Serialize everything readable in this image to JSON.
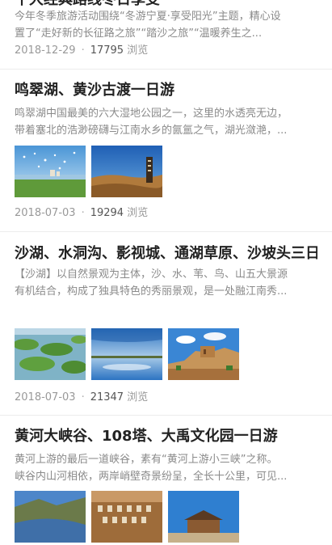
{
  "articles": [
    {
      "title": "十大经典路线冬日享受",
      "summary_lines": [
        "今年冬季旅游活动围绕“冬游宁夏·享受阳光”主题，精心设",
        "置了“走好新的长征路之旅”“踏沙之旅”“温暖养生之..."
      ],
      "date": "2018-12-29",
      "views": "17795",
      "views_label": "浏览"
    },
    {
      "title": "鸣翠湖、黄沙古渡一日游",
      "summary_lines": [
        "鸣翠湖中国最美的六大湿地公园之一，这里的水透亮无边，",
        "带着塞北的浩渺磅礴与江南水乡的氤氲之气，湖光潋滟，..."
      ],
      "date": "2018-07-03",
      "views": "19294",
      "views_label": "浏览"
    },
    {
      "title": "沙湖、水洞沟、影视城、通湖草原、沙坡头三日游",
      "summary_lines": [
        "【沙湖】以自然景观为主体，沙、水、苇、鸟、山五大景源",
        "有机结合，构成了独具特色的秀丽景观，是一处融江南秀..."
      ],
      "date": "2018-07-03",
      "views": "21347",
      "views_label": "浏览"
    },
    {
      "title": "黄河大峡谷、108塔、大禹文化园一日游",
      "summary_lines": [
        "黄河上游的最后一道峡谷，素有“黄河上游小三峡”之称。",
        "峡谷内山河相依，两岸峭壁奇景纷呈，全长十公里，可见..."
      ]
    }
  ]
}
